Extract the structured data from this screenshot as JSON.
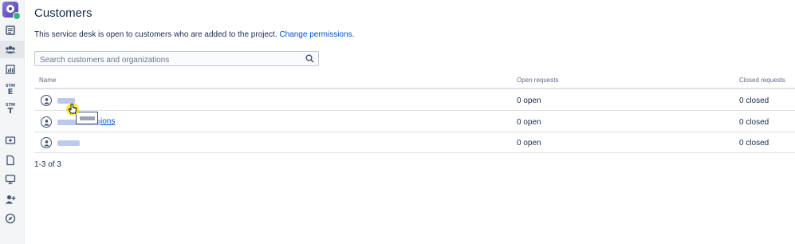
{
  "sidebar": {
    "items": [
      {
        "name": "queues-icon"
      },
      {
        "name": "customers-icon"
      },
      {
        "name": "reports-icon"
      },
      {
        "name": "stm-e-icon",
        "top": "STM",
        "letter": "E"
      },
      {
        "name": "stm-t-icon",
        "top": "STM",
        "letter": "T"
      },
      {
        "name": "add-item-icon"
      },
      {
        "name": "pages-icon"
      },
      {
        "name": "channels-icon"
      },
      {
        "name": "invite-team-icon"
      },
      {
        "name": "explore-icon"
      }
    ]
  },
  "page": {
    "title": "Customers",
    "intro_text": "This service desk is open to customers who are added to the project.",
    "change_permissions_link": "Change permissions",
    "intro_period": "."
  },
  "search": {
    "placeholder": "Search customers and organizations",
    "value": ""
  },
  "table": {
    "columns": [
      "Name",
      "Open requests",
      "Closed requests"
    ],
    "rows": [
      {
        "name_visible": "",
        "open": "0 open",
        "closed": "0 closed"
      },
      {
        "name_visible": "ions",
        "open": "0 open",
        "closed": "0 closed"
      },
      {
        "name_visible": "",
        "open": "0 open",
        "closed": "0 closed"
      }
    ]
  },
  "pagination": {
    "text": "1-3 of 3"
  },
  "colors": {
    "link": "#0052cc",
    "text": "#172b4d",
    "muted": "#5e6c84",
    "sidebar_bg": "#f4f5f7",
    "logo": "#5243aa",
    "logo_badge": "#36b37e"
  }
}
